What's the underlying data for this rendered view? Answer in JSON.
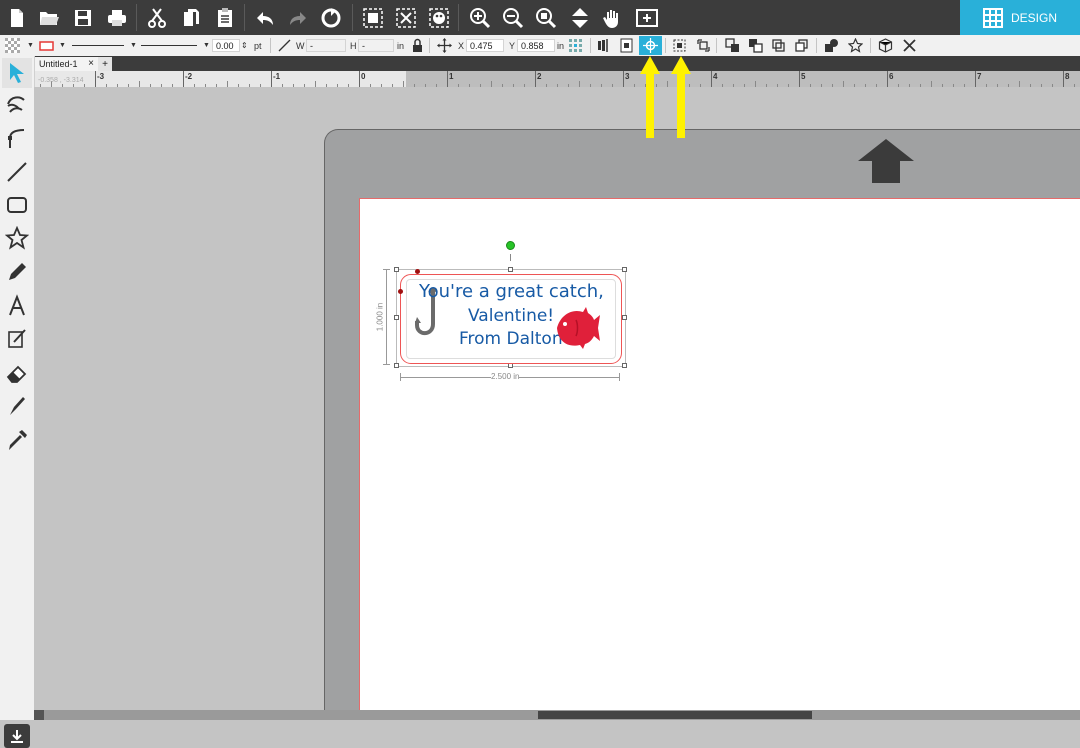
{
  "toolbar": {
    "icons": [
      "new-file-icon",
      "open-folder-icon",
      "save-icon",
      "print-icon",
      "cut-icon",
      "copy-icon",
      "paste-icon",
      "undo-icon",
      "redo-icon",
      "replicate-icon",
      "group-icon",
      "ungroup-icon",
      "fill-panel-icon",
      "zoom-in-icon",
      "zoom-out-icon",
      "zoom-selection-icon",
      "pan-down-icon",
      "hand-icon",
      "fit-page-icon"
    ],
    "design_label": "DESIGN"
  },
  "properties": {
    "line_width": "0.00",
    "line_unit": "pt",
    "w_label": "W",
    "w_value": "-",
    "h_label": "H",
    "h_value": "-",
    "size_unit": "in",
    "x_label": "X",
    "x_value": "0.475",
    "y_label": "Y",
    "y_value": "0.858",
    "pos_unit": "in"
  },
  "tabs": {
    "doc_name": "Untitled-1",
    "close": "×",
    "add": "+"
  },
  "ruler": {
    "labels": [
      "-3",
      "-2",
      "-1",
      "0",
      "1",
      "2",
      "3",
      "4",
      "5",
      "6",
      "7",
      "8"
    ],
    "coord": "-0.358 , -3.314"
  },
  "tools": [
    "select-arrow-icon",
    "point-edit-icon",
    "curve-icon",
    "line-icon",
    "rectangle-icon",
    "star-icon",
    "pencil-icon",
    "text-icon",
    "sketch-icon",
    "eraser-icon",
    "knife-icon",
    "eyedropper-icon"
  ],
  "design": {
    "line1": "You're a great catch,",
    "line2": "Valentine!",
    "line3": "From Dalton",
    "height_dim": "1.000 in",
    "width_dim": "2.500 in"
  },
  "colors": {
    "toolbar": "#3c3c3c",
    "accent": "#29b0d9",
    "text_blue": "#175aa5",
    "fish_red": "#e0203a",
    "annotation_yellow": "#fff200"
  }
}
